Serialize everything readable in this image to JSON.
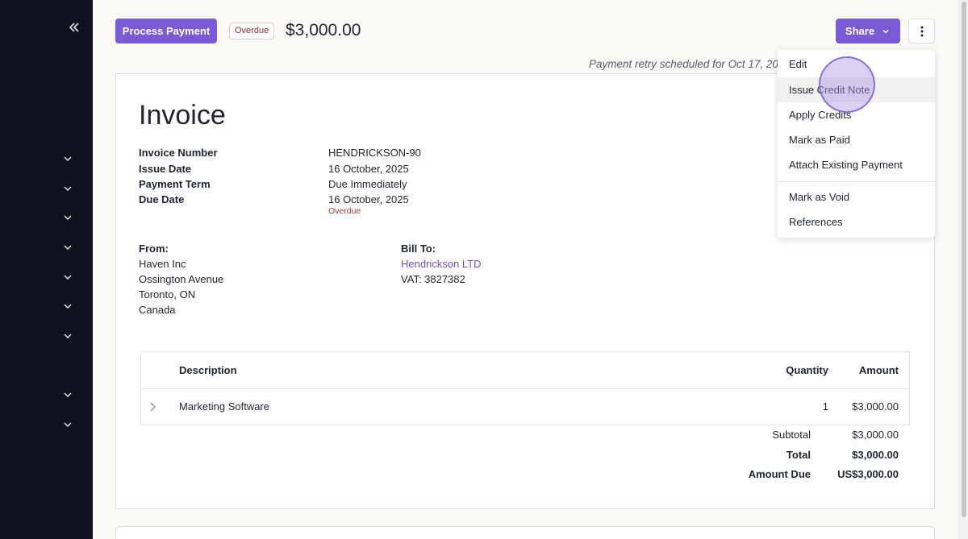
{
  "header": {
    "process_payment_label": "Process Payment",
    "status_badge": "Overdue",
    "amount": "$3,000.00",
    "share_label": "Share",
    "retry_note": "Payment retry scheduled for Oct 17, 2025"
  },
  "invoice": {
    "title": "Invoice",
    "meta": [
      {
        "label": "Invoice Number",
        "value": "HENDRICKSON-90"
      },
      {
        "label": "Issue Date",
        "value": "16 October, 2025"
      },
      {
        "label": "Payment Term",
        "value": "Due Immediately"
      },
      {
        "label": "Due Date",
        "value": "16 October, 2025"
      }
    ],
    "due_status": "Overdue",
    "from": {
      "label": "From:",
      "lines": [
        "Haven Inc",
        "Ossington Avenue",
        "Toronto, ON",
        "Canada"
      ]
    },
    "bill_to": {
      "label": "Bill To:",
      "company": "Hendrickson LTD",
      "vat": "VAT: 3827382"
    },
    "table": {
      "headers": {
        "description": "Description",
        "quantity": "Quantity",
        "amount": "Amount"
      },
      "rows": [
        {
          "description": "Marketing Software",
          "quantity": "1",
          "amount": "$3,000.00"
        }
      ]
    },
    "totals": {
      "subtotal_label": "Subtotal",
      "subtotal": "$3,000.00",
      "total_label": "Total",
      "total": "$3,000.00",
      "amount_due_label": "Amount Due",
      "amount_due": "US$3,000.00"
    }
  },
  "menu": {
    "items": [
      "Edit",
      "Issue Credit Note",
      "Apply Credits",
      "Mark as Paid",
      "Attach Existing Payment"
    ],
    "items_after_divider": [
      "Mark as Void",
      "References"
    ],
    "hovered": "Issue Credit Note"
  },
  "colors": {
    "accent": "#7b5ad6",
    "sidebar": "#0f1320",
    "overdue": "#a23b3b",
    "link": "#6a4fc6"
  },
  "icons": {
    "sidebar_toggle": "double-chevron-left-icon",
    "nav_expand": "chevron-down-icon",
    "share_caret": "chevron-down-icon",
    "more": "vertical-ellipsis-icon",
    "row_expand": "chevron-right-icon"
  }
}
